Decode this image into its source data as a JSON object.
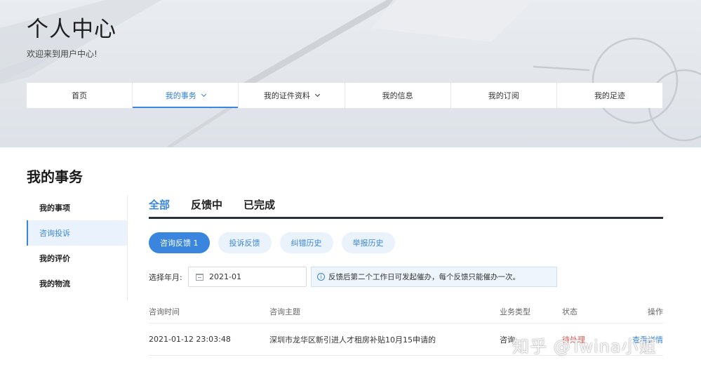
{
  "hero": {
    "title": "个人中心",
    "subtitle": "欢迎来到用户中心!"
  },
  "topnav": {
    "items": [
      {
        "label": "首页"
      },
      {
        "label": "我的事务"
      },
      {
        "label": "我的证件资料"
      },
      {
        "label": "我的信息"
      },
      {
        "label": "我的订阅"
      },
      {
        "label": "我的足迹"
      }
    ]
  },
  "section": {
    "title": "我的事务"
  },
  "sidebar": {
    "items": [
      {
        "label": "我的事项"
      },
      {
        "label": "咨询投诉"
      },
      {
        "label": "我的评价"
      },
      {
        "label": "我的物流"
      }
    ]
  },
  "tabs": {
    "items": [
      {
        "label": "全部"
      },
      {
        "label": "反馈中"
      },
      {
        "label": "已完成"
      }
    ]
  },
  "pills": {
    "items": [
      {
        "label": "咨询反馈 1"
      },
      {
        "label": "投诉反馈"
      },
      {
        "label": "纠错历史"
      },
      {
        "label": "举报历史"
      }
    ]
  },
  "filter": {
    "label": "选择年月:",
    "date_value": "2021-01",
    "notice": "反馈后第二个工作日可发起催办，每个反馈只能催办一次。"
  },
  "table": {
    "headers": [
      "咨询时间",
      "咨询主题",
      "业务类型",
      "状态",
      "操作"
    ],
    "rows": [
      {
        "time": "2021-01-12 23:03:48",
        "topic": "深圳市龙华区新引进人才租房补贴10月15申请的",
        "type": "咨询",
        "status": "待处理",
        "action": "查看详情"
      }
    ]
  },
  "watermark": "知乎 @Twina小姐",
  "colors": {
    "accent": "#3a86de",
    "tab_underline": "#2b2f3a",
    "status": "#e05a4f"
  }
}
